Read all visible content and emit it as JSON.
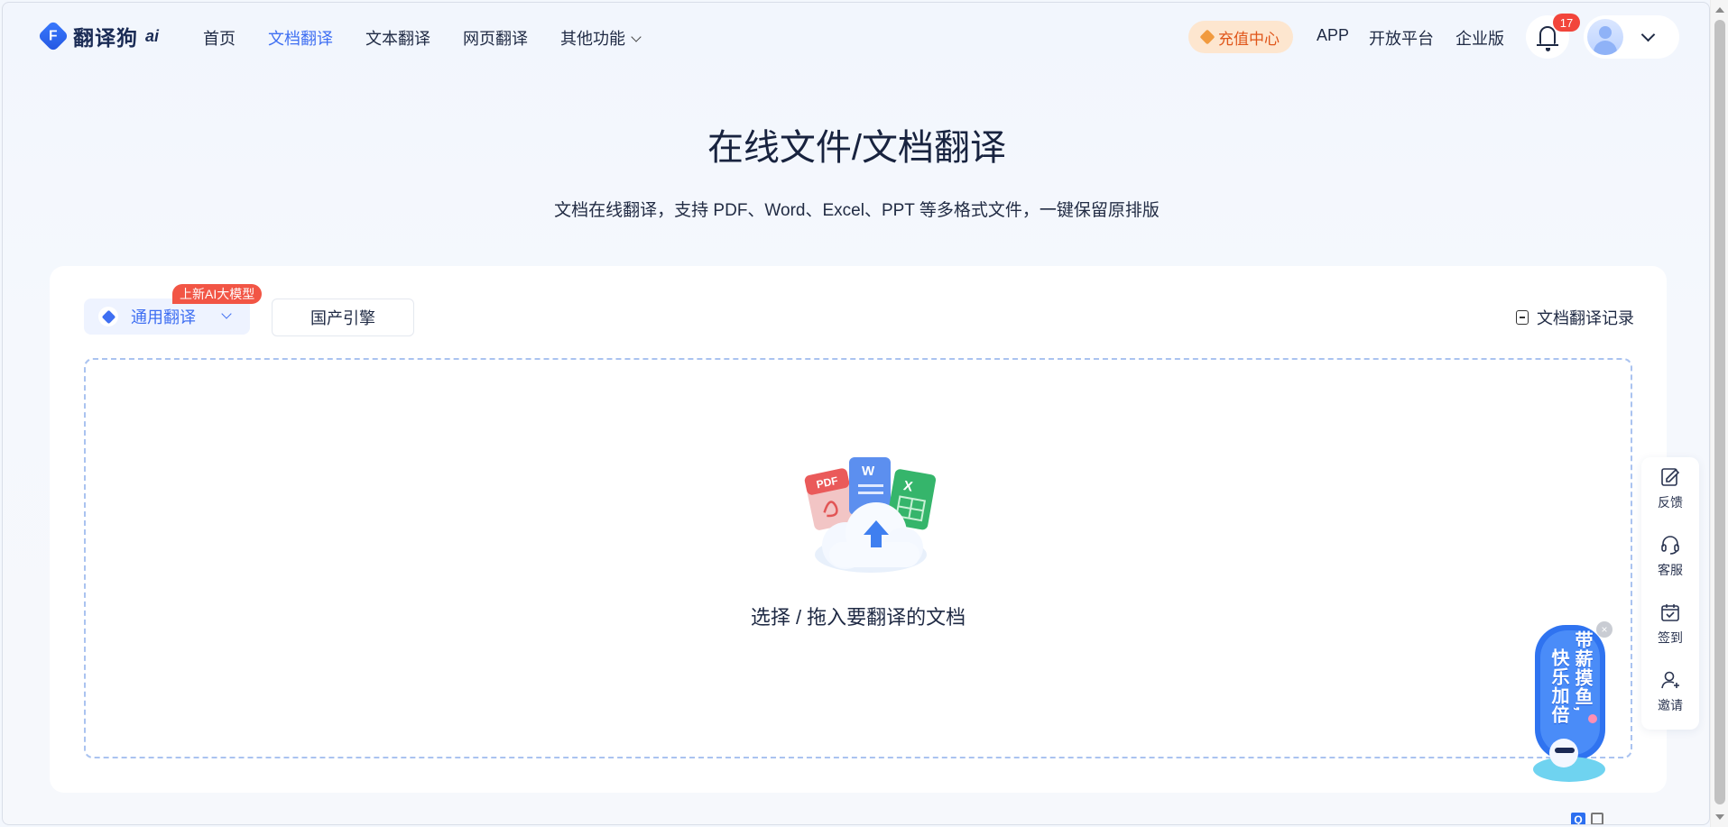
{
  "header": {
    "logo_text": "翻译狗",
    "logo_ai": "ai",
    "nav": [
      "首页",
      "文档翻译",
      "文本翻译",
      "网页翻译",
      "其他功能"
    ],
    "active_nav": "文档翻译",
    "recharge": "充值中心",
    "app": "APP",
    "open_platform": "开放平台",
    "enterprise": "企业版",
    "notification_count": "17"
  },
  "hero": {
    "title": "在线文件/文档翻译",
    "subtitle": "文档在线翻译，支持 PDF、Word、Excel、PPT 等多格式文件，一键保留原排版"
  },
  "card": {
    "engine_label": "通用翻译",
    "new_tag": "上新AI大模型",
    "domestic_label": "国产引擎",
    "history_label": "文档翻译记录",
    "dropzone_text": "选择 / 拖入要翻译的文档",
    "file_badges": [
      "PDF",
      "W",
      "X"
    ]
  },
  "side_tools": [
    "反馈",
    "客服",
    "签到",
    "邀请"
  ],
  "promo": {
    "line1": "带薪摸鱼,",
    "line2": "快乐加倍"
  },
  "colors": {
    "accent": "#3f6ff2",
    "badge": "#f2453b",
    "recharge_text": "#e0561a",
    "recharge_bg": "#fde6cf"
  }
}
